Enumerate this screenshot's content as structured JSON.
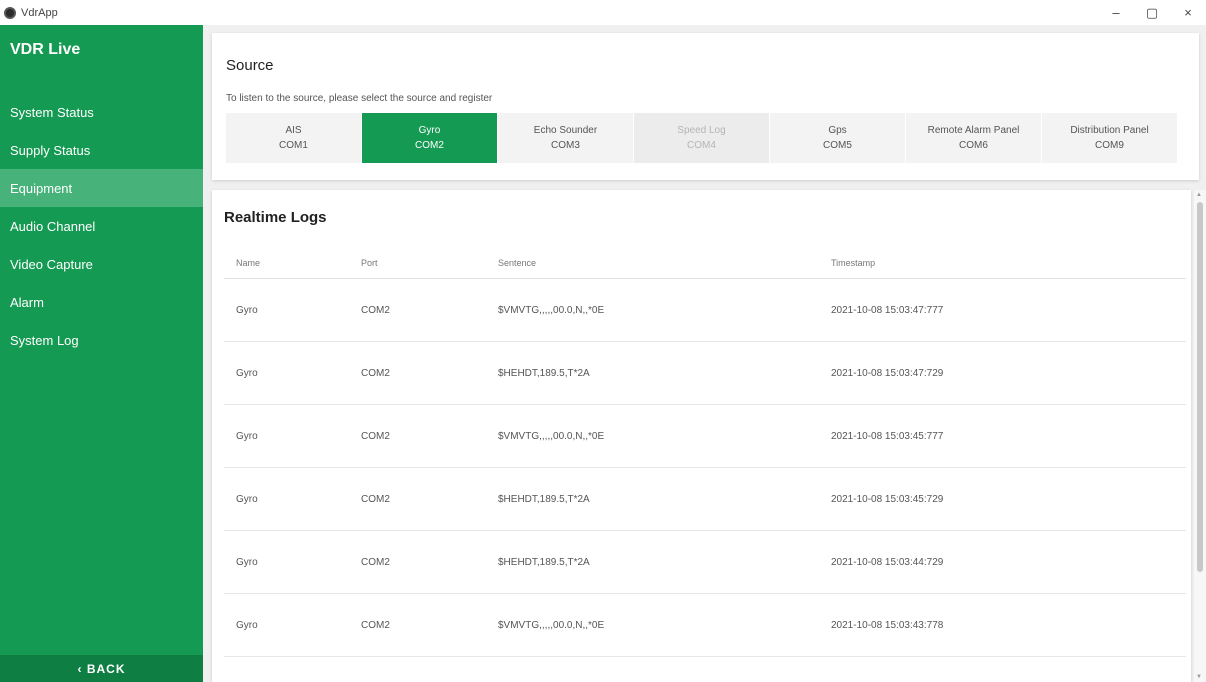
{
  "app": {
    "title": "VdrApp",
    "window_controls": {
      "minimize": "–",
      "maximize": "▢",
      "close": "×"
    }
  },
  "sidebar": {
    "brand": "VDR Live",
    "items": [
      {
        "label": "System Status"
      },
      {
        "label": "Supply Status"
      },
      {
        "label": "Equipment"
      },
      {
        "label": "Audio Channel"
      },
      {
        "label": "Video Capture"
      },
      {
        "label": "Alarm"
      },
      {
        "label": "System Log"
      }
    ],
    "active_index": 2,
    "back_label": "‹  BACK"
  },
  "source": {
    "title": "Source",
    "hint": "To listen to the source, please select the source and register",
    "options": [
      {
        "name": "AIS",
        "port": "COM1",
        "state": "normal"
      },
      {
        "name": "Gyro",
        "port": "COM2",
        "state": "selected"
      },
      {
        "name": "Echo Sounder",
        "port": "COM3",
        "state": "normal"
      },
      {
        "name": "Speed Log",
        "port": "COM4",
        "state": "disabled"
      },
      {
        "name": "Gps",
        "port": "COM5",
        "state": "normal"
      },
      {
        "name": "Remote Alarm Panel",
        "port": "COM6",
        "state": "normal"
      },
      {
        "name": "Distribution Panel",
        "port": "COM9",
        "state": "normal"
      }
    ]
  },
  "logs": {
    "title": "Realtime Logs",
    "columns": {
      "name": "Name",
      "port": "Port",
      "sentence": "Sentence",
      "timestamp": "Timestamp"
    },
    "rows": [
      {
        "name": "Gyro",
        "port": "COM2",
        "sentence": "$VMVTG,,,,,00.0,N,,*0E",
        "timestamp": "2021-10-08 15:03:47:777"
      },
      {
        "name": "Gyro",
        "port": "COM2",
        "sentence": "$HEHDT,189.5,T*2A",
        "timestamp": "2021-10-08 15:03:47:729"
      },
      {
        "name": "Gyro",
        "port": "COM2",
        "sentence": "$VMVTG,,,,,00.0,N,,*0E",
        "timestamp": "2021-10-08 15:03:45:777"
      },
      {
        "name": "Gyro",
        "port": "COM2",
        "sentence": "$HEHDT,189.5,T*2A",
        "timestamp": "2021-10-08 15:03:45:729"
      },
      {
        "name": "Gyro",
        "port": "COM2",
        "sentence": "$HEHDT,189.5,T*2A",
        "timestamp": "2021-10-08 15:03:44:729"
      },
      {
        "name": "Gyro",
        "port": "COM2",
        "sentence": "$VMVTG,,,,,00.0,N,,*0E",
        "timestamp": "2021-10-08 15:03:43:778"
      }
    ]
  },
  "colors": {
    "brand_green": "#159a53",
    "active_item": "#47b37b",
    "back_bar": "#0f7e42"
  }
}
